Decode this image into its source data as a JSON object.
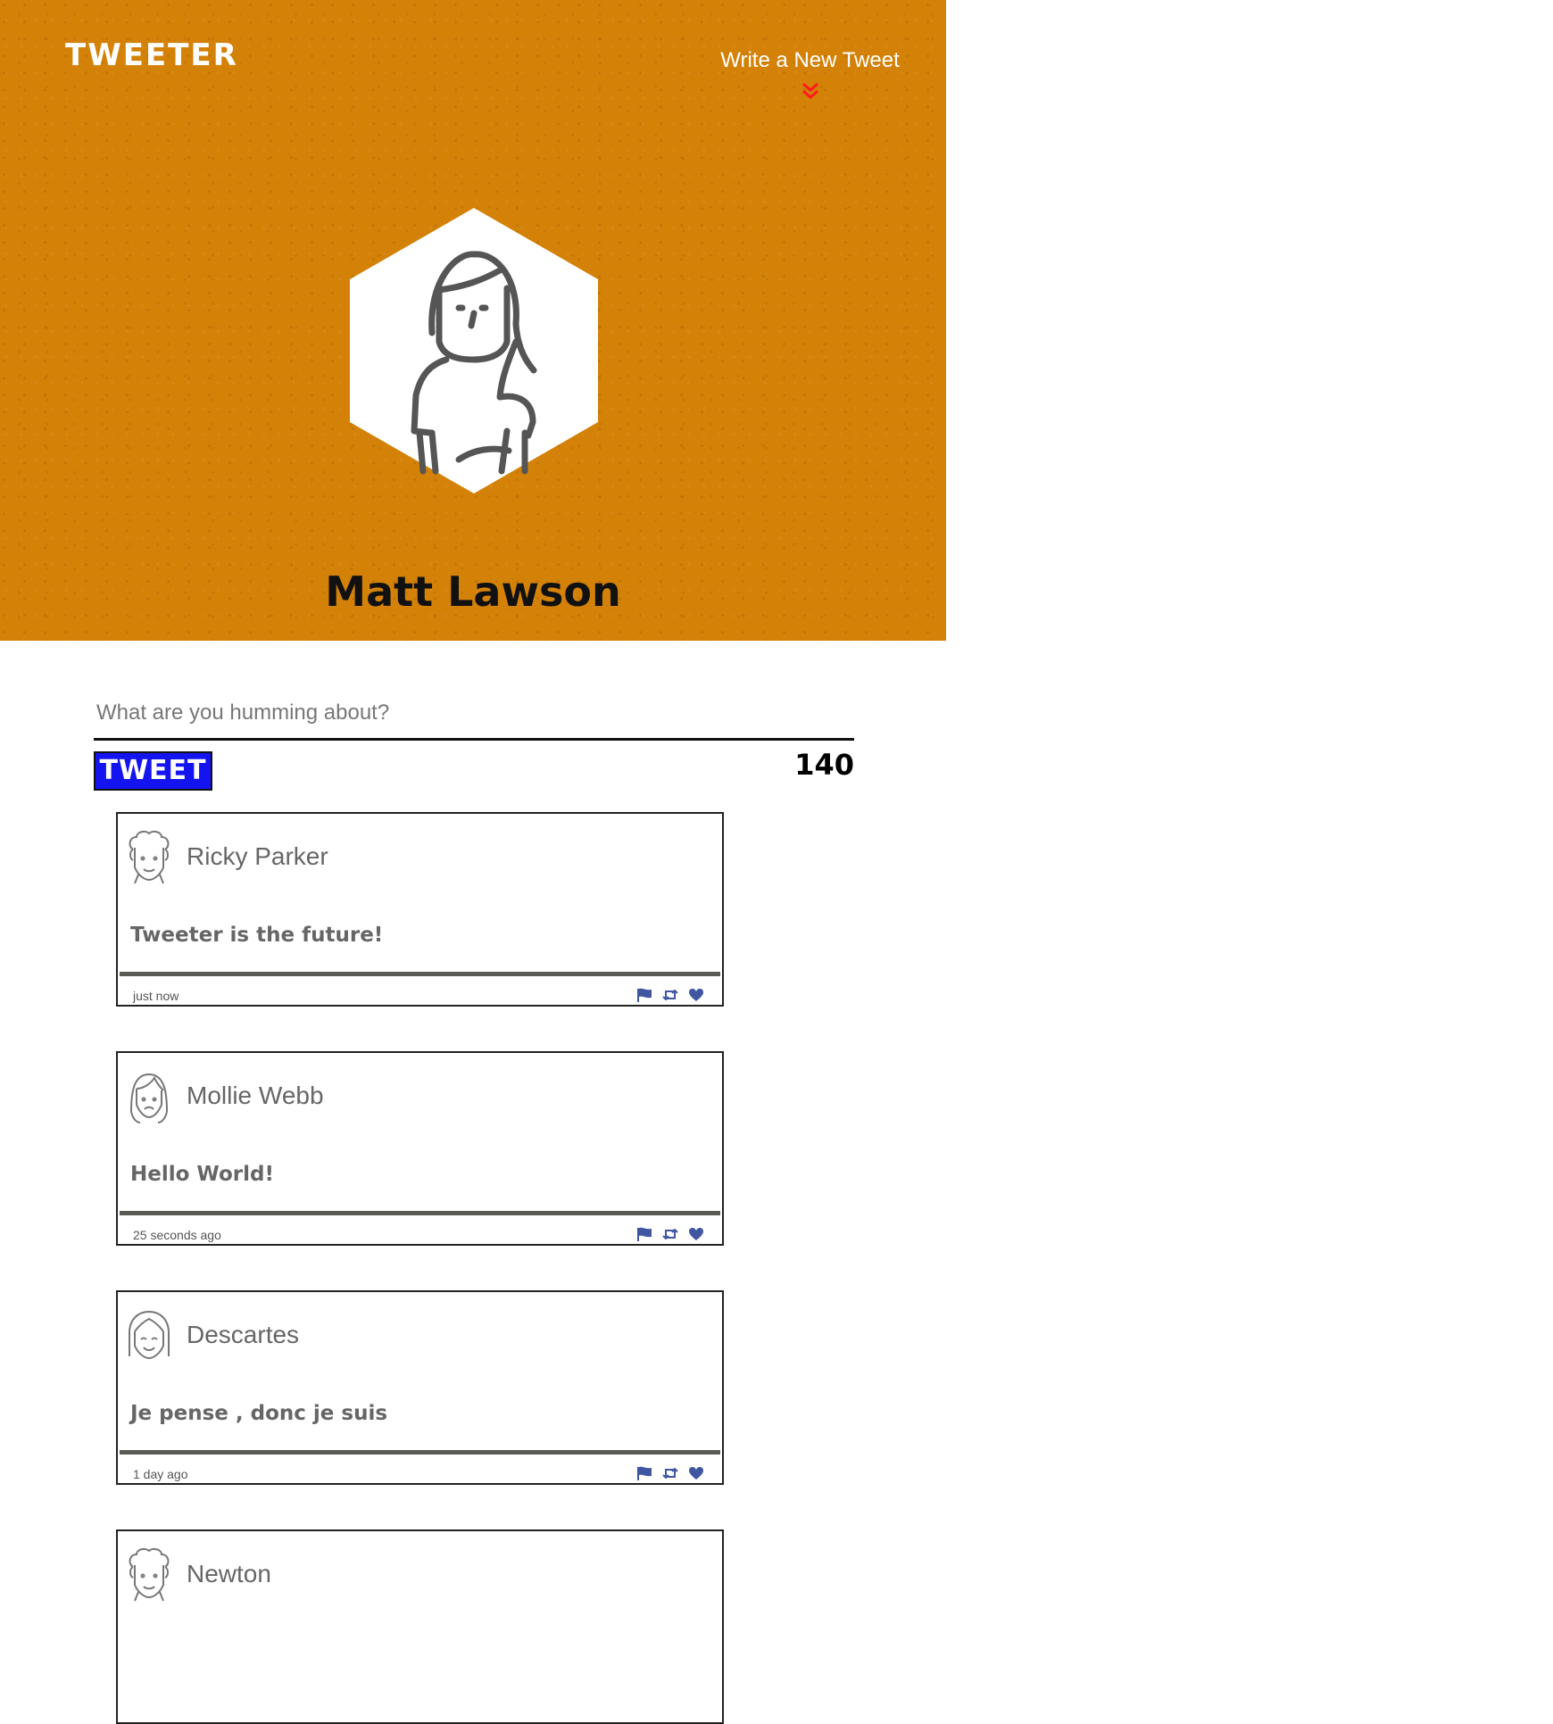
{
  "header": {
    "logo": "TWEETER",
    "compose_label": "Write a New Tweet",
    "profile_name": "Matt Lawson"
  },
  "composer": {
    "placeholder": "What are you humming about?",
    "submit_label": "TWEET",
    "char_count": "140"
  },
  "tweets": [
    {
      "author": "Ricky Parker",
      "content": "Tweeter is the future!",
      "time": "just now",
      "avatar": "curly-hair-avatar-icon"
    },
    {
      "author": "Mollie Webb",
      "content": "Hello World!",
      "time": "25 seconds ago",
      "avatar": "long-hair-avatar-icon"
    },
    {
      "author": "Descartes",
      "content": "Je pense , donc je suis",
      "time": "1 day ago",
      "avatar": "bob-hair-avatar-icon"
    },
    {
      "author": "Newton",
      "content": "",
      "time": "",
      "avatar": "curly-hair-avatar-icon"
    }
  ],
  "colors": {
    "header_background": "#d48207",
    "tweet_button_background": "#1414f0",
    "compose_arrow": "#ff1a1a",
    "action_icons": "#4056a1"
  },
  "icons": [
    "double-chevron-down-icon",
    "flag-icon",
    "retweet-icon",
    "heart-icon"
  ]
}
